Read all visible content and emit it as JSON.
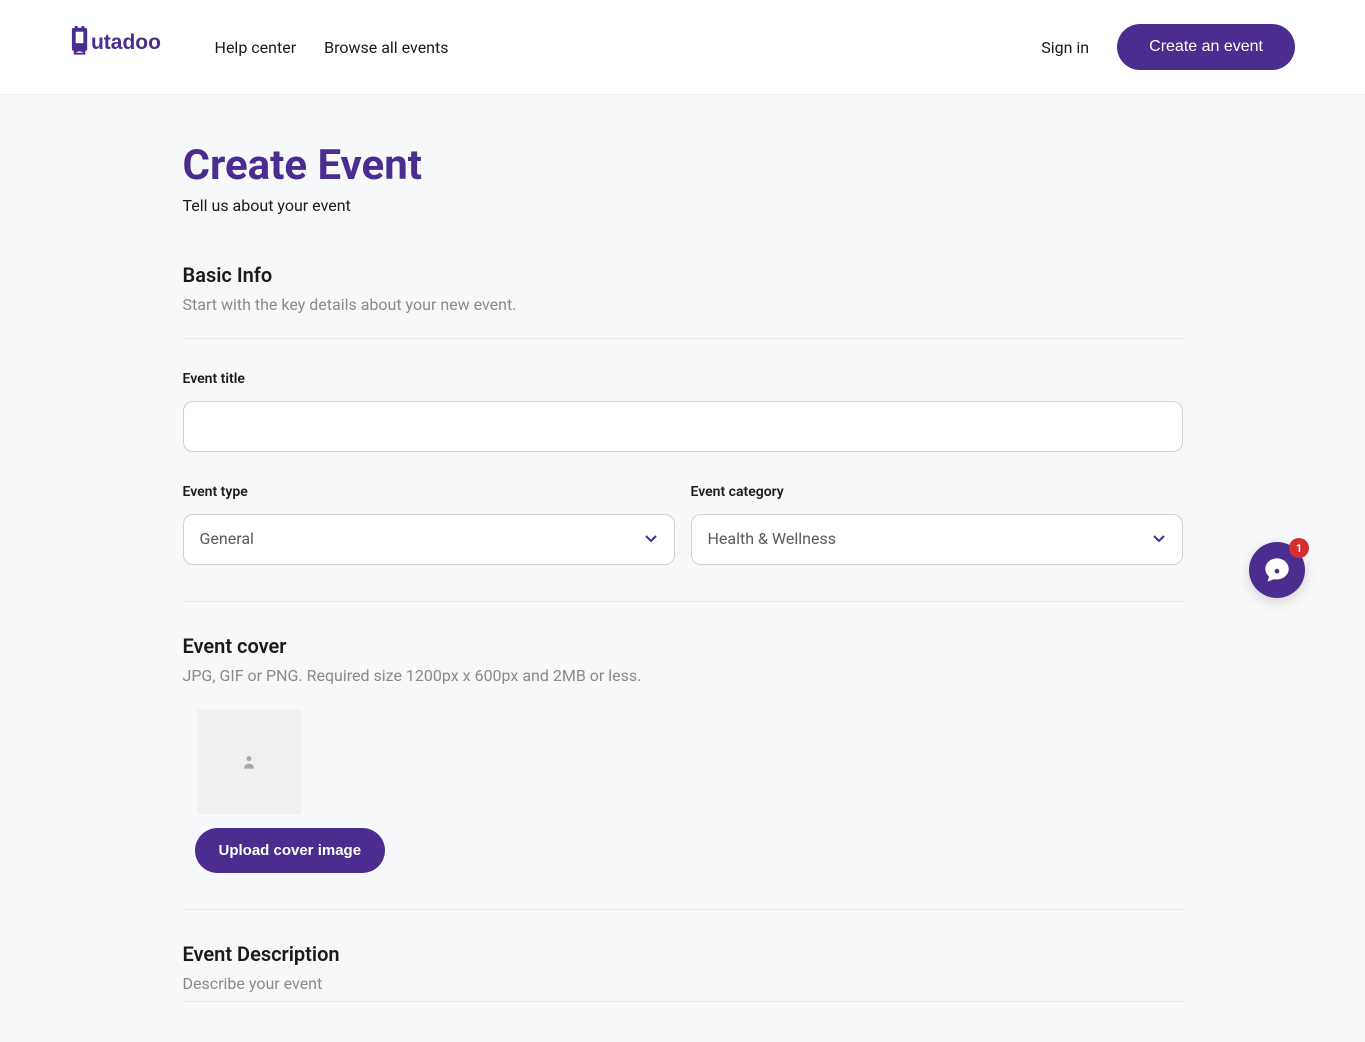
{
  "header": {
    "logo_text": "tutadoo",
    "nav": {
      "help_center": "Help center",
      "browse_events": "Browse all events"
    },
    "signin": "Sign in",
    "create_event_btn": "Create an event"
  },
  "page": {
    "title": "Create Event",
    "subtitle": "Tell us about your event"
  },
  "basic_info": {
    "title": "Basic Info",
    "subtitle": "Start with the key details about your new event.",
    "event_title_label": "Event title",
    "event_type_label": "Event type",
    "event_type_value": "General",
    "event_category_label": "Event category",
    "event_category_value": "Health & Wellness"
  },
  "event_cover": {
    "title": "Event cover",
    "subtitle": "JPG, GIF or PNG. Required size 1200px x 600px and 2MB or less.",
    "upload_btn": "Upload cover image"
  },
  "event_description": {
    "title": "Event Description",
    "subtitle": "Describe your event"
  },
  "chat": {
    "badge_count": "1"
  }
}
